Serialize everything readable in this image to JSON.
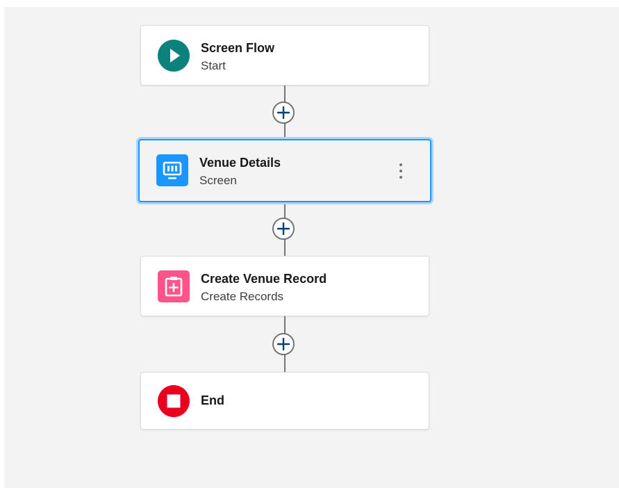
{
  "flow": {
    "nodes": {
      "start": {
        "title": "Screen Flow",
        "subtitle": "Start",
        "icon": "play-icon",
        "color": "#0b827c"
      },
      "screen": {
        "title": "Venue Details",
        "subtitle": "Screen",
        "icon": "screen-icon",
        "color": "#1b96ff"
      },
      "create": {
        "title": "Create Venue Record",
        "subtitle": "Create Records",
        "icon": "create-records-icon",
        "color": "#ff538a"
      },
      "end": {
        "title": "End",
        "icon": "stop-icon",
        "color": "#ea001e"
      }
    },
    "add_button_icon": "plus-icon",
    "selected_node": "screen"
  }
}
